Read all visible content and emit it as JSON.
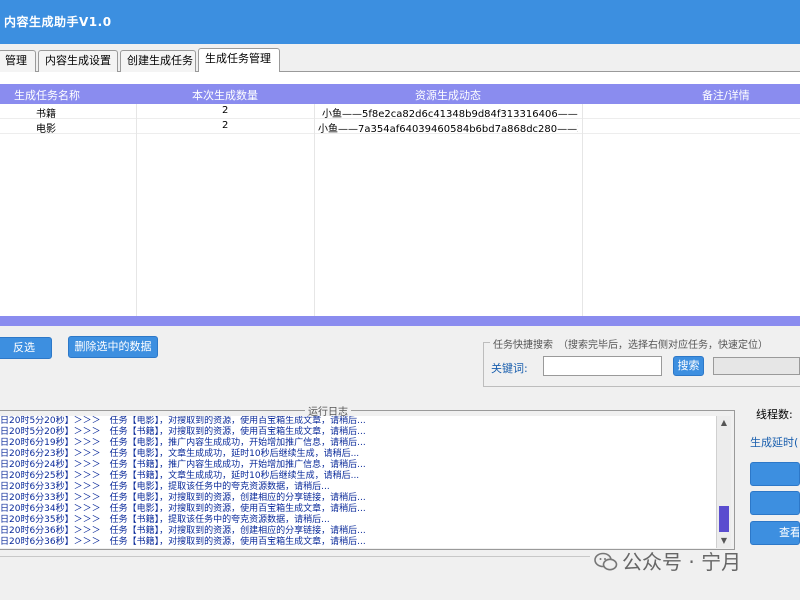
{
  "window": {
    "title": "内容生成助手V1.0"
  },
  "tabs": [
    {
      "label": "管理"
    },
    {
      "label": "内容生成设置"
    },
    {
      "label": "创建生成任务"
    },
    {
      "label": "生成任务管理"
    }
  ],
  "table": {
    "columns": [
      "生成任务名称",
      "本次生成数量",
      "资源生成动态",
      "备注/详情"
    ],
    "rows": [
      {
        "name": "书籍",
        "count": "2",
        "status": "小鱼——5f8e2ca82d6c41348b9d84f313316406——...",
        "note": ""
      },
      {
        "name": "电影",
        "count": "2",
        "status": "小鱼——7a354af64039460584b6bd7a868dc280——2...",
        "note": ""
      }
    ]
  },
  "actions": {
    "invert_label": "反选",
    "delete_label": "删除选中的数据"
  },
  "search": {
    "group_title": "任务快捷搜索　（搜索完毕后，选择右侧对应任务，快速定位）",
    "keyword_label": "关键词:",
    "keyword_value": "",
    "search_label": "搜索"
  },
  "log": {
    "title": "运行日志",
    "lines": [
      "日20时5分20秒】＞＞＞　任务【电影】，对搜取到的资源，使用百宝箱生成文章，请稍后...",
      "日20时5分20秒】＞＞＞　任务【书籍】，对搜取到的资源，使用百宝箱生成文章，请稍后...",
      "日20时6分19秒】＞＞＞　任务【电影】，推广内容生成成功，开始增加推广信息，请稍后...",
      "日20时6分23秒】＞＞＞　任务【电影】，文章生成成功，延时10秒后继续生成，请稍后...",
      "日20时6分24秒】＞＞＞　任务【书籍】，推广内容生成成功，开始增加推广信息，请稍后...",
      "日20时6分25秒】＞＞＞　任务【书籍】，文章生成成功，延时10秒后继续生成，请稍后...",
      "日20时6分33秒】＞＞＞　任务【电影】，提取该任务中的夸克资源数据，请稍后...",
      "日20时6分33秒】＞＞＞　任务【电影】，对搜取到的资源，创建相应的分享链接，请稍后...",
      "日20时6分34秒】＞＞＞　任务【电影】，对搜取到的资源，使用百宝箱生成文章，请稍后...",
      "日20时6分35秒】＞＞＞　任务【书籍】，提取该任务中的夸克资源数据，请稍后...",
      "日20时6分36秒】＞＞＞　任务【书籍】，对搜取到的资源，创建相应的分享链接，请稍后...",
      "日20时6分36秒】＞＞＞　任务【书籍】，对搜取到的资源，使用百宝箱生成文章，请稍后..."
    ]
  },
  "side": {
    "threads_label": "线程数:",
    "delay_label": "生成延时(",
    "buttons": [
      "",
      "",
      "查看"
    ]
  },
  "watermark": {
    "text": "公众号 · 宁月"
  }
}
